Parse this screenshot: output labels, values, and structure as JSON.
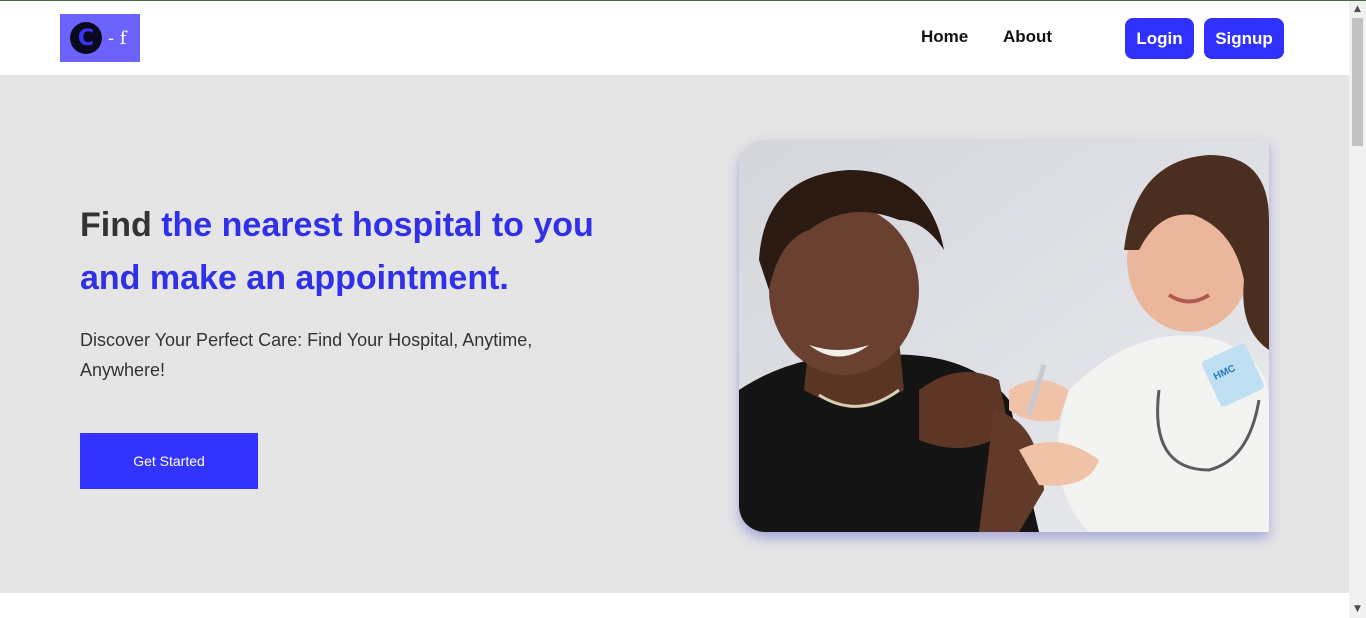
{
  "brand": {
    "logo_letter": "C",
    "logo_suffix": "- f",
    "accent_color": "#3030ff",
    "logo_bg": "#6c63ff"
  },
  "nav": {
    "links": [
      {
        "label": "Home"
      },
      {
        "label": "About"
      }
    ],
    "login_label": "Login",
    "signup_label": "Signup"
  },
  "hero": {
    "headline_plain": "Find ",
    "headline_accent": "the nearest hospital to you and make an appointment.",
    "subtext": "Discover Your Perfect Care: Find Your Hospital, Anytime, Anywhere!",
    "cta_label": "Get Started",
    "image_badge": "HMC"
  },
  "scrollbar": {
    "up_icon": "triangle-up-icon",
    "down_icon": "triangle-down-icon"
  }
}
